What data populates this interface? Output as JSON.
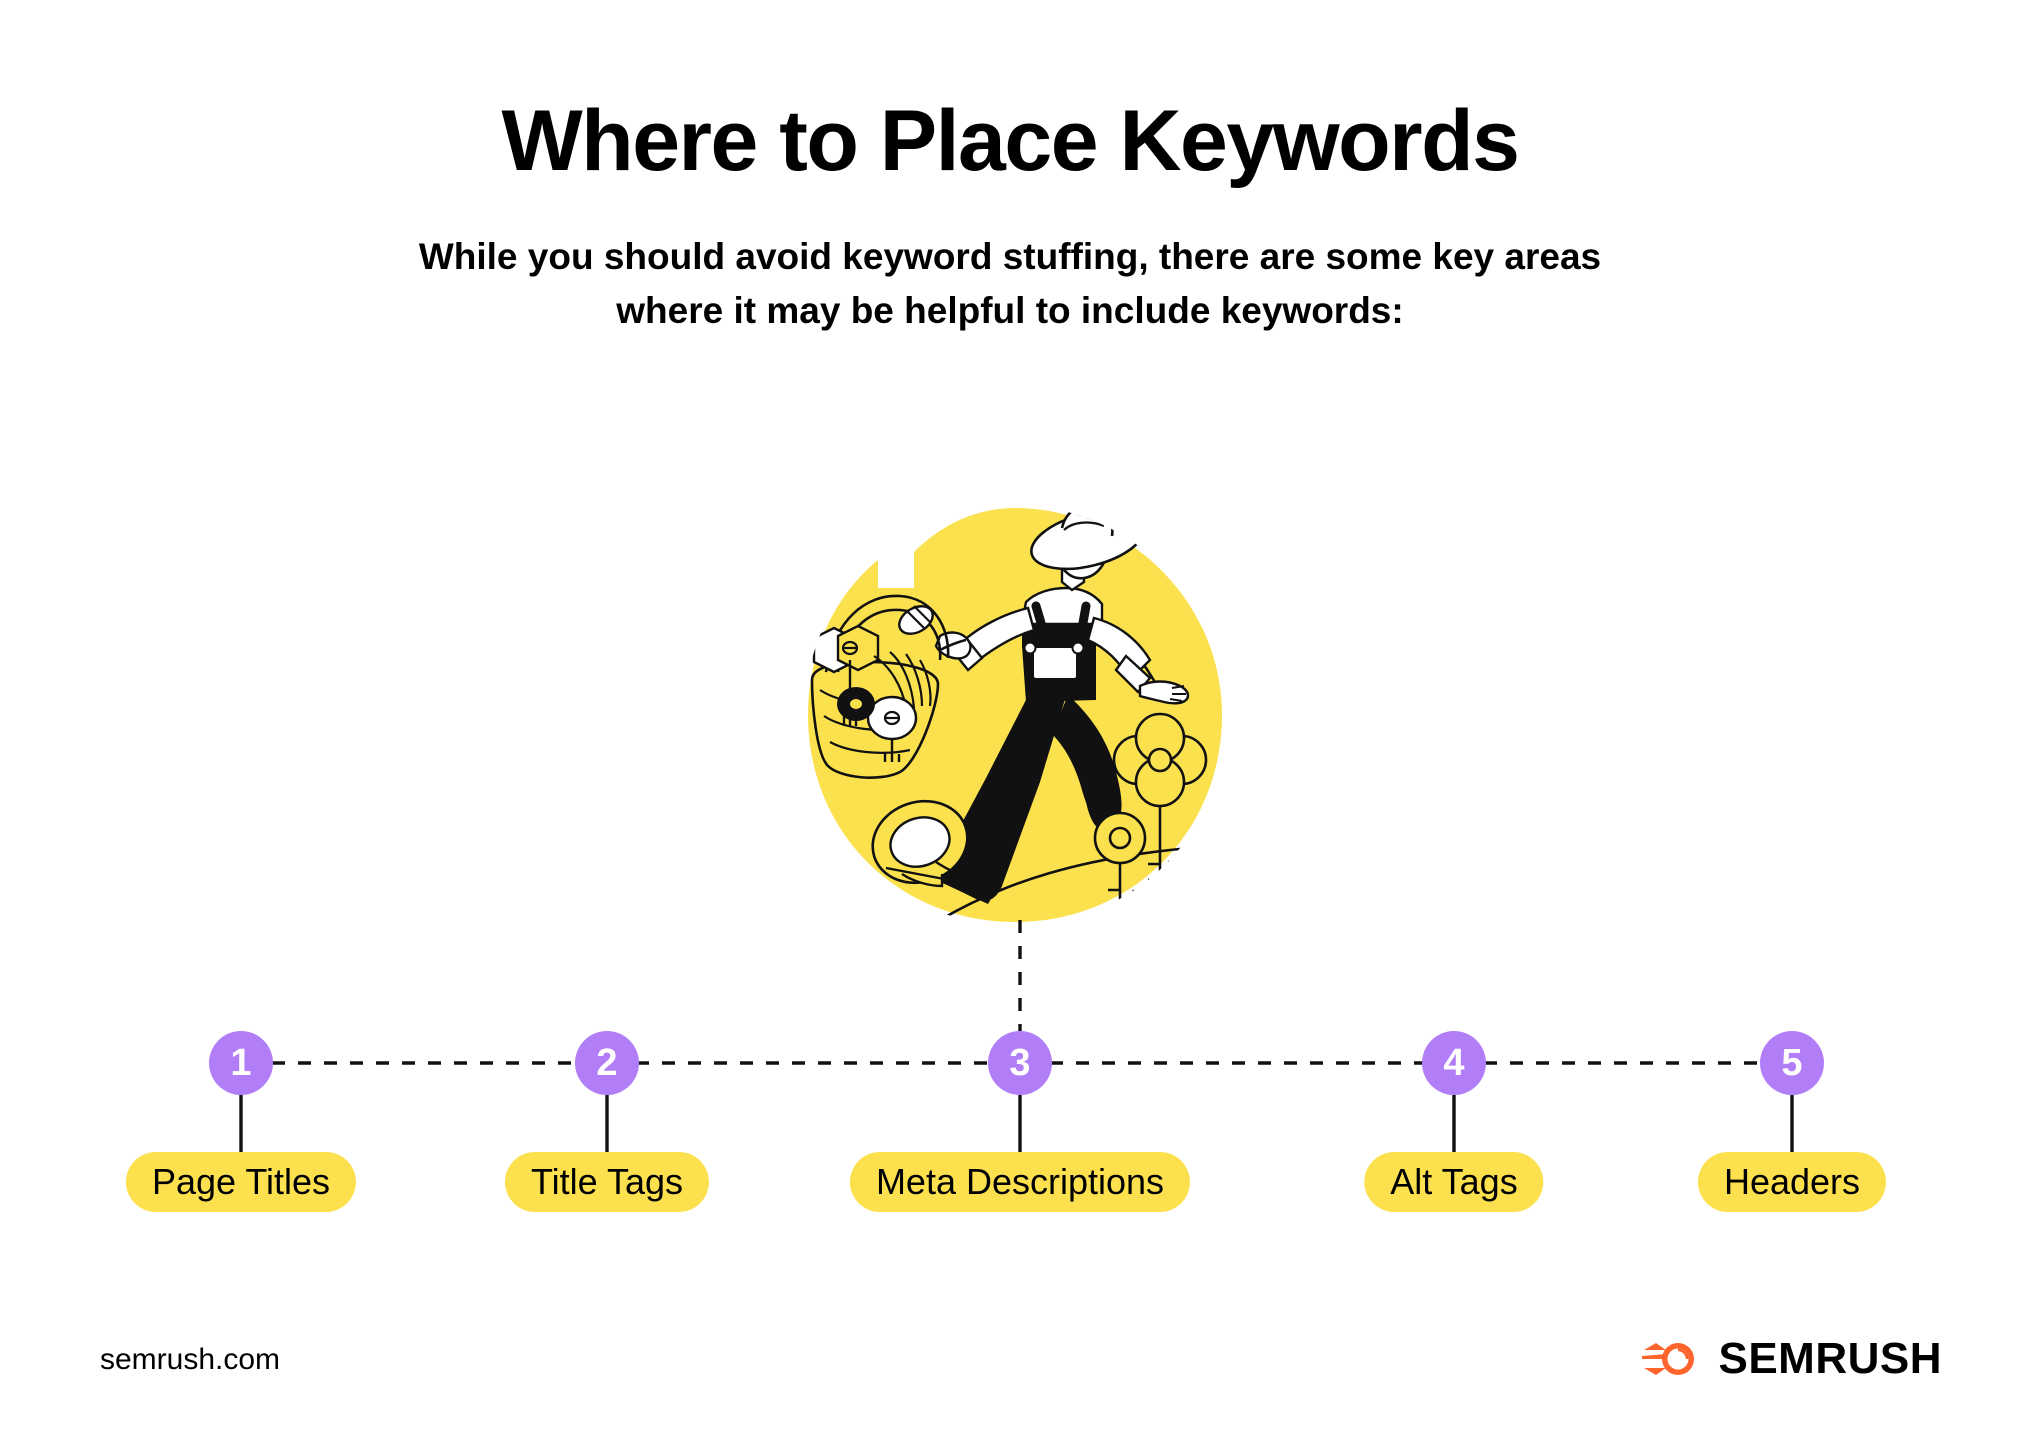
{
  "header": {
    "title": "Where to Place Keywords",
    "subtitle_line1": "While you should avoid keyword stuffing, there are some key areas",
    "subtitle_line2": "where it may be helpful to include keywords:"
  },
  "illustration": {
    "name": "farmer-with-basket-of-keys-illustration",
    "description": "Farmer in overalls and sun hat walking, carrying a basket of keys, with key-shaped flowers",
    "background_color": "#FBE14E"
  },
  "steps": [
    {
      "number": "1",
      "label": "Page Titles"
    },
    {
      "number": "2",
      "label": "Title Tags"
    },
    {
      "number": "3",
      "label": "Meta Descriptions"
    },
    {
      "number": "4",
      "label": "Alt Tags"
    },
    {
      "number": "5",
      "label": "Headers"
    }
  ],
  "footer": {
    "url": "semrush.com",
    "brand_name": "SEMRUSH"
  },
  "colors": {
    "yellow": "#FCE04E",
    "illustration_yellow": "#FBE14E",
    "purple": "#B27EF8",
    "black": "#000000",
    "white": "#FFFFFF",
    "brand_orange": "#FF642D"
  }
}
